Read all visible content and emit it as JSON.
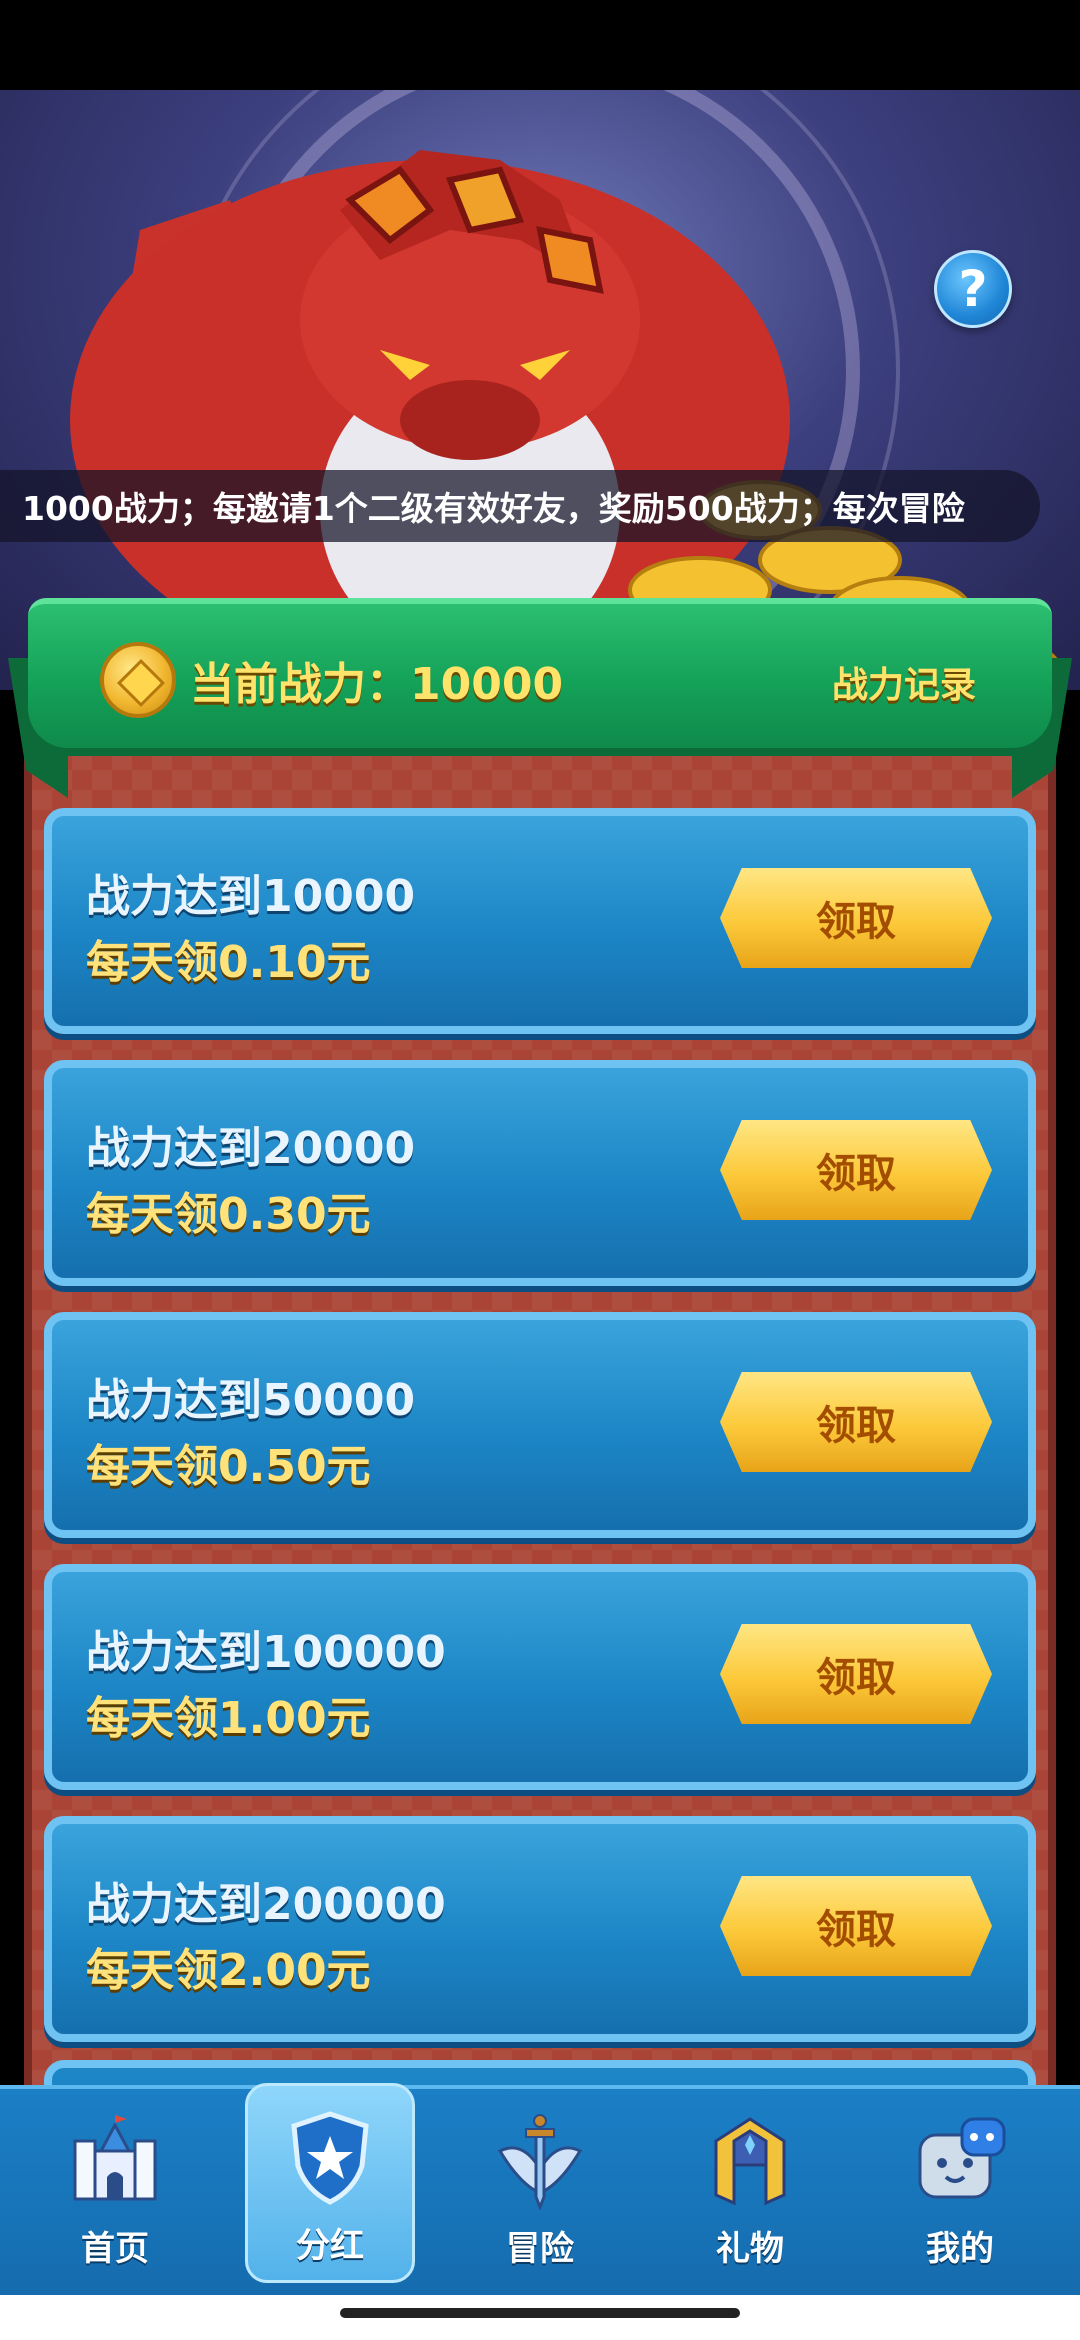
{
  "help": {
    "label": "?"
  },
  "marquee": {
    "text": "1000战力；每邀请1个二级有效好友，奖励500战力；每次冒险"
  },
  "banner": {
    "power_label": "当前战力：",
    "power_value": "10000",
    "record_link": "战力记录"
  },
  "tiers": [
    {
      "title": "战力达到10000",
      "reward": "每天领0.10元",
      "button": "领取"
    },
    {
      "title": "战力达到20000",
      "reward": "每天领0.30元",
      "button": "领取"
    },
    {
      "title": "战力达到50000",
      "reward": "每天领0.50元",
      "button": "领取"
    },
    {
      "title": "战力达到100000",
      "reward": "每天领1.00元",
      "button": "领取"
    },
    {
      "title": "战力达到200000",
      "reward": "每天领2.00元",
      "button": "领取"
    }
  ],
  "tabbar": {
    "active": "分红",
    "items": [
      {
        "label": "首页",
        "icon": "castle-icon"
      },
      {
        "label": "分红",
        "icon": "shield-star-icon"
      },
      {
        "label": "冒险",
        "icon": "sword-icon"
      },
      {
        "label": "礼物",
        "icon": "helmet-icon"
      },
      {
        "label": "我的",
        "icon": "robot-face-icon"
      }
    ]
  },
  "colors": {
    "banner_green": "#14a158",
    "tier_blue": "#1c86c6",
    "button_gold": "#fcc93a",
    "board_red": "#a94436"
  }
}
